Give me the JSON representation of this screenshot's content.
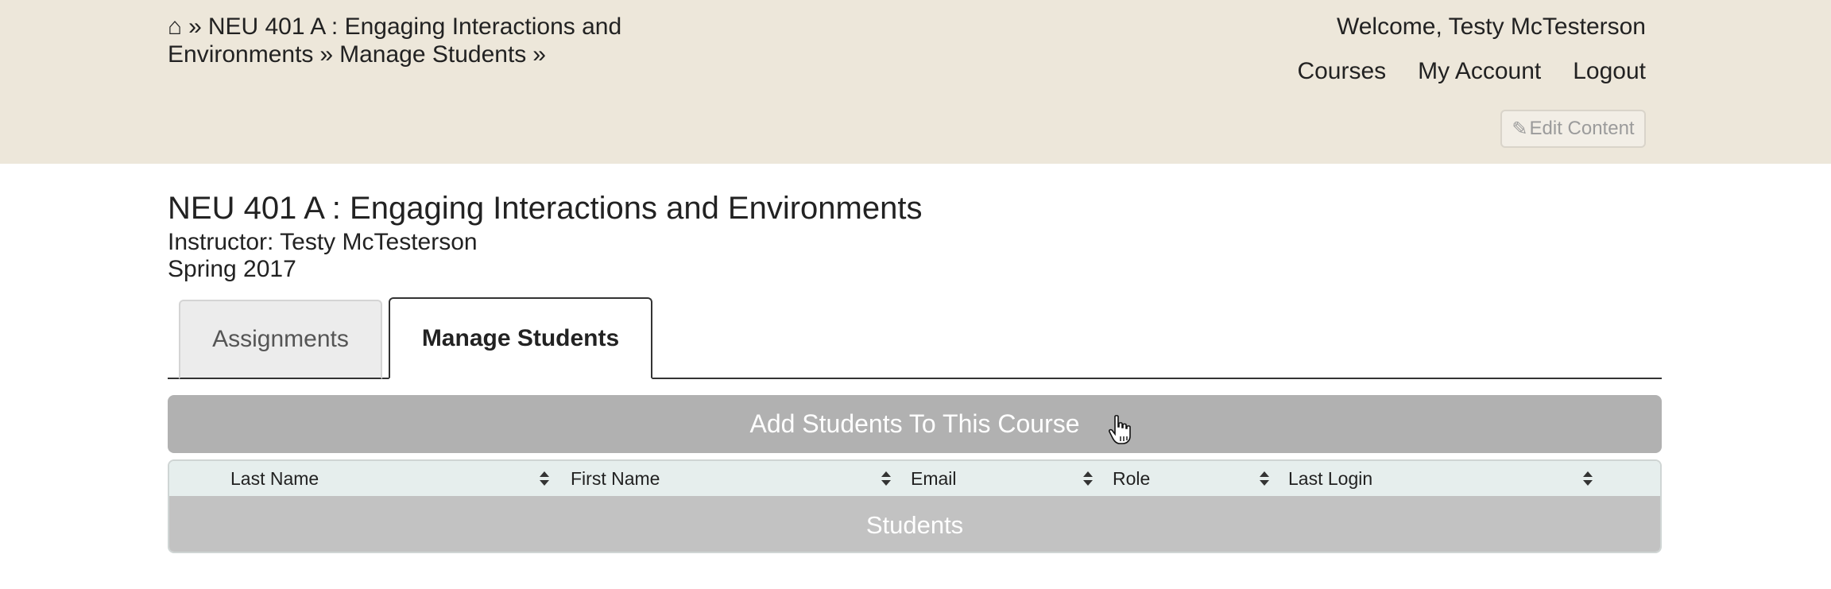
{
  "header": {
    "breadcrumb": {
      "home_icon": "home-icon",
      "separator": "»",
      "items": [
        "NEU 401 A : Engaging Interactions and Environments",
        "Manage Students"
      ]
    },
    "welcome": "Welcome, Testy McTesterson",
    "nav": [
      "Courses",
      "My Account",
      "Logout"
    ],
    "edit_button": {
      "icon": "pencil-icon",
      "label": "Edit Content"
    }
  },
  "course": {
    "title": "NEU 401 A : Engaging Interactions and Environments",
    "instructor": "Instructor: Testy McTesterson",
    "term": "Spring 2017"
  },
  "tabs": [
    {
      "label": "Assignments",
      "active": false
    },
    {
      "label": "Manage Students",
      "active": true
    }
  ],
  "add_students_button": "Add Students To This Course",
  "table": {
    "columns": [
      "Last Name",
      "First Name",
      "Email",
      "Role",
      "Last Login"
    ],
    "group_label": "Students"
  },
  "colors": {
    "header_bg": "#ede7da",
    "button_gray": "#b1b1b1",
    "table_header_bg": "#e6eeed",
    "group_bg": "#c2c2c2"
  }
}
